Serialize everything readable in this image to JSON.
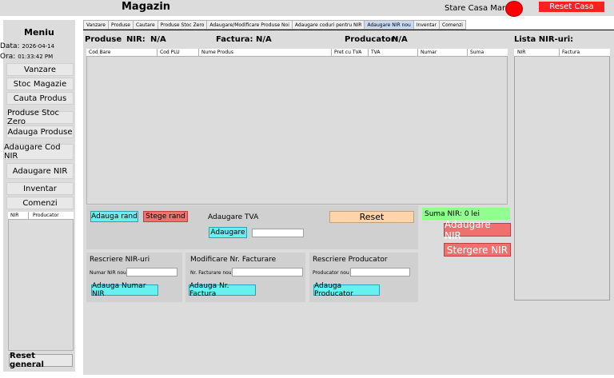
{
  "app": {
    "title": "Magazin"
  },
  "status": {
    "label": "Stare Casa Marcat:",
    "indicator_color": "#ff0000",
    "reset_casa_label": "Reset Casa"
  },
  "sidebar": {
    "title": "Meniu",
    "date_label": "Data:",
    "date_value": "2026-04-14",
    "time_label": "Ora:",
    "time_value": "01:33:42 PM",
    "items": [
      {
        "label": "Vanzare"
      },
      {
        "label": "Stoc Magazie"
      },
      {
        "label": "Cauta Produs"
      },
      {
        "label": "Produse Stoc Zero"
      },
      {
        "label": "Adauga Produse"
      },
      {
        "label": "Adaugare Cod NIR"
      },
      {
        "label": "Adaugare NIR"
      },
      {
        "label": "Inventar"
      },
      {
        "label": "Comenzi"
      }
    ],
    "list_columns": [
      "NIR",
      "Producator"
    ],
    "reset_general_label": "Reset general"
  },
  "tabs": [
    {
      "label": "Vanzare",
      "active": false
    },
    {
      "label": "Produse",
      "active": false
    },
    {
      "label": "Cautare",
      "active": false
    },
    {
      "label": "Produse Stoc Zero",
      "active": false
    },
    {
      "label": "Adaugare/Modificare Produse Noi",
      "active": false
    },
    {
      "label": "Adaugare coduri pentru NIR",
      "active": false
    },
    {
      "label": "Adaugare NIR nou",
      "active": true
    },
    {
      "label": "Inventar",
      "active": false
    },
    {
      "label": "Comenzi",
      "active": false
    }
  ],
  "header": {
    "produse_label": "Produse",
    "nir_label": "NIR:",
    "nir_value": "N/A",
    "factura_label": "Factura:",
    "factura_value": "N/A",
    "producator_label": "Producator:",
    "producator_value": "N/A",
    "lista_nir_label": "Lista NIR-uri:"
  },
  "grid": {
    "columns": [
      "Cod Bare",
      "Cod PLU",
      "Nume Produs",
      "Pret cu TVA",
      "TVA",
      "Numar",
      "Suma"
    ]
  },
  "lista": {
    "columns": [
      "NIR",
      "Factura"
    ]
  },
  "actions": {
    "adauga_rand": "Adauga rand",
    "sterge_rand": "Stege rand",
    "adaugare_tva_title": "Adaugare TVA",
    "adaugare_button": "Adaugare",
    "tva_value": "",
    "reset_label": "Reset",
    "suma_nir": "Suma NIR:  0 lei",
    "adaugare_nir": "Adaugare NIR",
    "stergere_nir": "Stergere NIR"
  },
  "rescriere_nir": {
    "title": "Rescriere NIR-uri",
    "field_label": "Numar NIR nou",
    "field_value": "",
    "button": "Adauga Numar NIR"
  },
  "modificare_factura": {
    "title": "Modificare Nr. Facturare",
    "field_label": "Nr. Facturare nou",
    "field_value": "",
    "button": "Adauga Nr. Factura"
  },
  "rescriere_producator": {
    "title": "Rescriere Producator",
    "field_label": "Producator nou",
    "field_value": "",
    "button": "Adauga Producator"
  }
}
